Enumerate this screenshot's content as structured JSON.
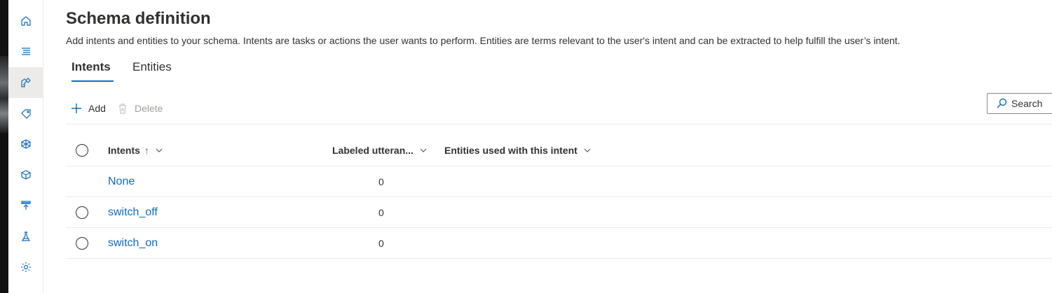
{
  "page": {
    "title": "Schema definition",
    "description": "Add intents and entities to your schema. Intents are tasks or actions the user wants to perform. Entities are terms relevant to the user's intent and can be extracted to help fulfill the user’s intent."
  },
  "tabs": [
    {
      "label": "Intents",
      "selected": true
    },
    {
      "label": "Entities",
      "selected": false
    }
  ],
  "toolbar": {
    "add_label": "Add",
    "delete_label": "Delete",
    "delete_disabled": true
  },
  "search": {
    "placeholder": "Search"
  },
  "table": {
    "columns": [
      "Intents",
      "Labeled utteran...",
      "Entities used with this intent"
    ],
    "sort_indicator": "↑",
    "rows": [
      {
        "intent": "None",
        "labeled": "0",
        "entities": "",
        "selectable": false
      },
      {
        "intent": "switch_off",
        "labeled": "0",
        "entities": "",
        "selectable": true
      },
      {
        "intent": "switch_on",
        "labeled": "0",
        "entities": "",
        "selectable": true
      }
    ]
  },
  "nav": {
    "items": [
      {
        "icon": "home-icon"
      },
      {
        "icon": "list-icon"
      },
      {
        "icon": "schema-build-icon",
        "active": true
      },
      {
        "icon": "tag-icon"
      },
      {
        "icon": "model-icon"
      },
      {
        "icon": "box-icon"
      },
      {
        "icon": "deploy-icon"
      },
      {
        "icon": "test-flask-icon"
      },
      {
        "icon": "settings-gear-icon"
      }
    ]
  },
  "colors": {
    "accent": "#0f6cbd",
    "border": "#edebe9",
    "text": "#323130"
  }
}
